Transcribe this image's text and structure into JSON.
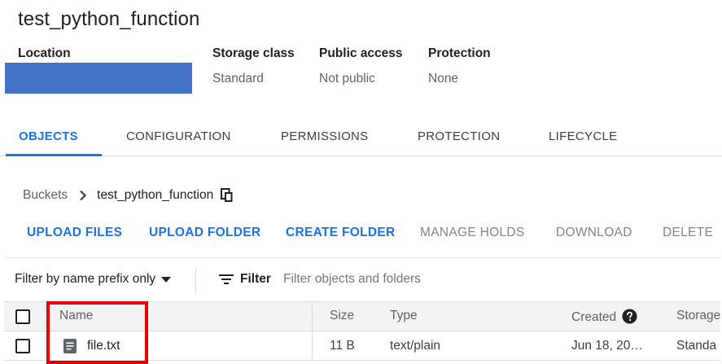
{
  "bucket": {
    "title": "test_python_function"
  },
  "meta": {
    "location_label": "Location",
    "storage_class_label": "Storage class",
    "storage_class_value": "Standard",
    "public_access_label": "Public access",
    "public_access_value": "Not public",
    "protection_label": "Protection",
    "protection_value": "None"
  },
  "tabs": [
    {
      "label": "OBJECTS",
      "active": true
    },
    {
      "label": "CONFIGURATION",
      "active": false
    },
    {
      "label": "PERMISSIONS",
      "active": false
    },
    {
      "label": "PROTECTION",
      "active": false
    },
    {
      "label": "LIFECYCLE",
      "active": false
    }
  ],
  "breadcrumb": {
    "root": "Buckets",
    "current": "test_python_function"
  },
  "actions": [
    {
      "label": "UPLOAD FILES",
      "enabled": true
    },
    {
      "label": "UPLOAD FOLDER",
      "enabled": true
    },
    {
      "label": "CREATE FOLDER",
      "enabled": true
    },
    {
      "label": "MANAGE HOLDS",
      "enabled": false
    },
    {
      "label": "DOWNLOAD",
      "enabled": false
    },
    {
      "label": "DELETE",
      "enabled": false
    }
  ],
  "filter": {
    "mode_label": "Filter by name prefix only",
    "button_label": "Filter",
    "placeholder": "Filter objects and folders"
  },
  "table": {
    "columns": [
      "Name",
      "Size",
      "Type",
      "Created",
      "Storage"
    ],
    "rows": [
      {
        "name": "file.txt",
        "size": "11 B",
        "type": "text/plain",
        "created": "Jun 18, 20…",
        "storage": "Standa"
      }
    ]
  },
  "colors": {
    "accent": "#1a73e8",
    "highlight": "#e60000",
    "redaction": "#4472c4"
  },
  "icons": {
    "chevron": "chevron-right-icon",
    "copy": "copy-icon",
    "dropdown": "arrow-drop-down-icon",
    "filter": "filter-list-icon",
    "help": "help-icon",
    "file": "text-file-icon"
  }
}
